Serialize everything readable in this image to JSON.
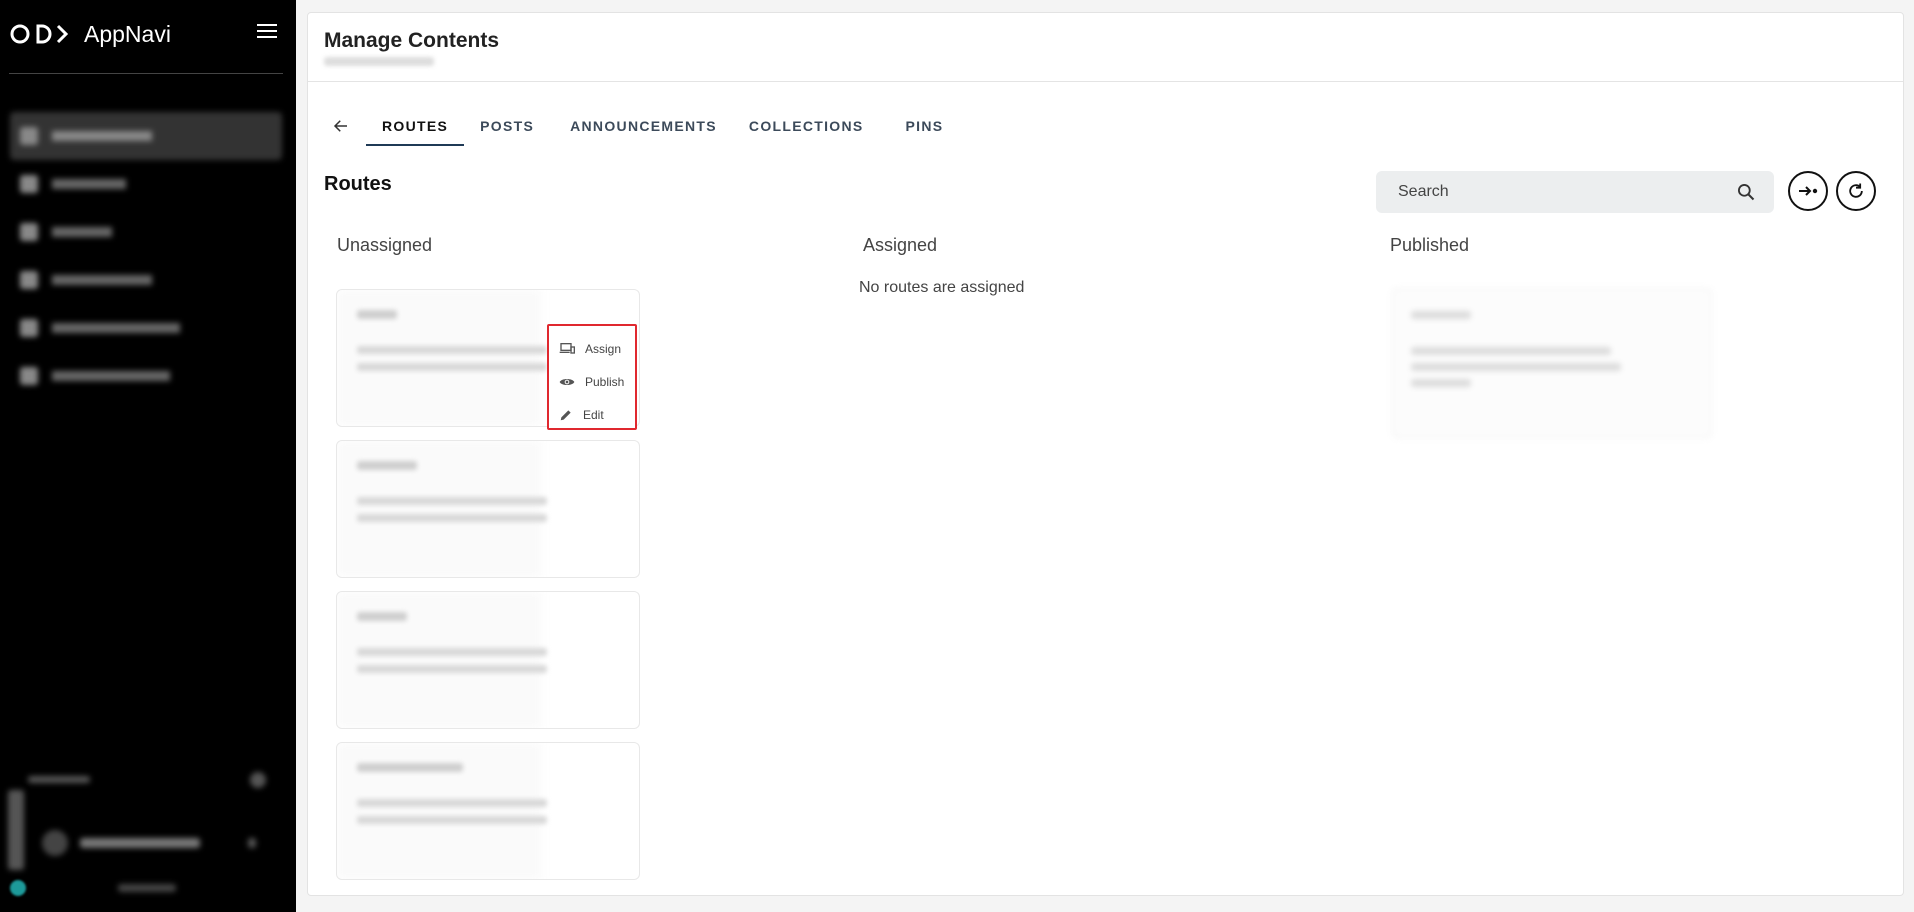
{
  "app": {
    "name": "AppNavi"
  },
  "header": {
    "title": "Manage Contents"
  },
  "tabs": [
    {
      "label": "ROUTES",
      "active": true
    },
    {
      "label": "POSTS",
      "active": false
    },
    {
      "label": "ANNOUNCEMENTS",
      "active": false
    },
    {
      "label": "COLLECTIONS",
      "active": false
    },
    {
      "label": "PINS",
      "active": false
    }
  ],
  "section": {
    "title": "Routes"
  },
  "search": {
    "placeholder": "Search"
  },
  "columns": {
    "unassigned": "Unassigned",
    "assigned": "Assigned",
    "published": "Published"
  },
  "assigned": {
    "empty_message": "No routes are assigned"
  },
  "context_menu": {
    "assign": "Assign",
    "publish": "Publish",
    "edit": "Edit"
  },
  "icons": {
    "back": "arrow-left-icon",
    "search": "search-icon",
    "export": "arrow-right-dot-icon",
    "refresh": "refresh-icon",
    "menu": "hamburger-icon",
    "assign": "devices-icon",
    "publish": "eye-icon",
    "edit": "pencil-icon"
  },
  "colors": {
    "sidebar": "#000000",
    "accent": "#1f3a56",
    "highlight": "#e0282f"
  }
}
